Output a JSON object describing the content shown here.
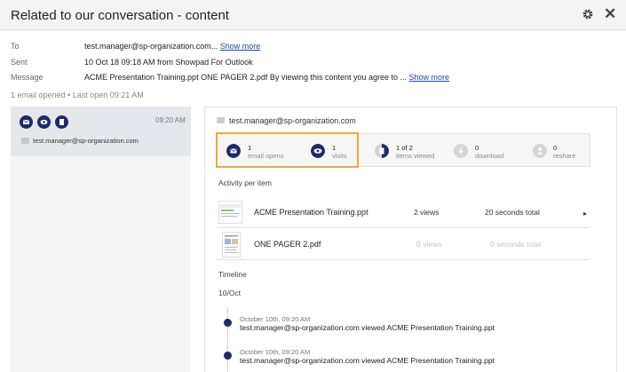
{
  "window": {
    "title": "Related to our conversation - content"
  },
  "icons": [
    "gear-icon",
    "close-icon",
    "mail-icon",
    "eye-icon",
    "document-icon",
    "download-icon",
    "reshare-icon",
    "chevron-right-icon"
  ],
  "colors": {
    "accent_navy": "#1e2a68",
    "highlight_orange": "#f3a83a",
    "link_blue": "#1f4aa8",
    "muted_icon": "#cfcfcf"
  },
  "header": {
    "close_glyph": "✕"
  },
  "meta": {
    "to_label": "To",
    "to_value": "test.manager@sp-organization.com...",
    "to_more": "Show more",
    "sent_label": "Sent",
    "sent_value": "10 Oct 18 09:18 AM from Showpad For Outlook",
    "message_label": "Message",
    "message_value": "ACME Presentation Training.ppt ONE PAGER 2.pdf By viewing this content you agree to ...",
    "message_more": "Show more"
  },
  "summary": "1 email opened • Last open 09:21 AM",
  "left": {
    "time": "09:20 AM",
    "email": "test.manager@sp-organization.com"
  },
  "detail": {
    "recipient": "test.manager@sp-organization.com",
    "stats": {
      "email_opens_num": "1",
      "email_opens_lbl": "email opens",
      "visits_num": "1",
      "visits_lbl": "visits",
      "items_num": "1 of 2",
      "items_lbl": "items viewed",
      "download_num": "0",
      "download_lbl": "download",
      "reshare_num": "0",
      "reshare_lbl": "reshare"
    },
    "activity_title": "Activity per item",
    "items": [
      {
        "name": "ACME Presentation Training.ppt",
        "views": "2 views",
        "time": "20 seconds total"
      },
      {
        "name": "ONE PAGER 2.pdf",
        "views": "0 views",
        "time": "0 seconds total"
      }
    ],
    "chevron": "▸",
    "timeline_title": "Timeline",
    "timeline_date": "10/Oct",
    "events": [
      {
        "date": "October 10th, 09:20 AM",
        "text": "test.manager@sp-organization.com viewed ACME Presentation Training.ppt"
      },
      {
        "date": "October 10th, 09:20 AM",
        "text": "test.manager@sp-organization.com viewed ACME Presentation Training.ppt"
      }
    ]
  }
}
